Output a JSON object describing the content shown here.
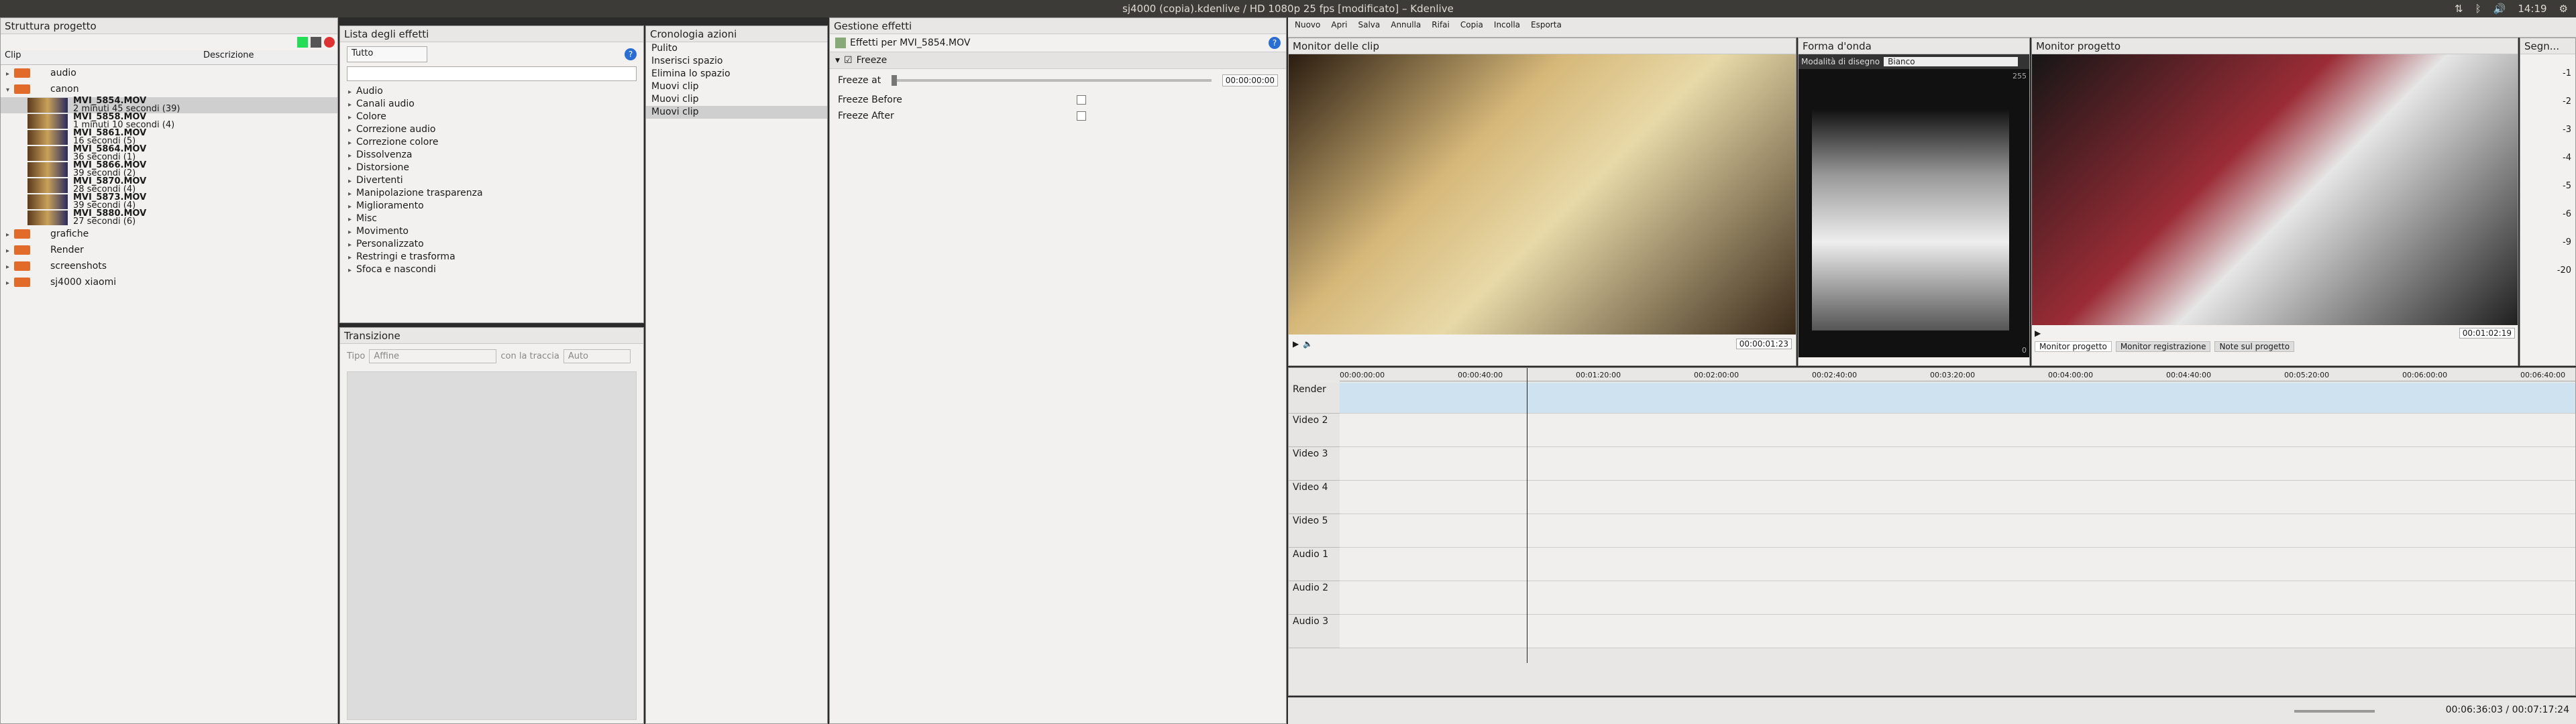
{
  "window": {
    "title": "sj4000 (copia).kdenlive / HD 1080p 25 fps [modificato] – Kdenlive",
    "clock": "14:19"
  },
  "project": {
    "title": "Struttura progetto",
    "col_clip": "Clip",
    "col_desc": "Descrizione",
    "tree": [
      {
        "type": "folder",
        "name": "audio",
        "open": false
      },
      {
        "type": "folder",
        "name": "canon",
        "open": true
      },
      {
        "type": "clip",
        "name": "MVI_5854.MOV",
        "desc": "2 minuti 45 secondi (39)",
        "selected": true
      },
      {
        "type": "clip",
        "name": "MVI_5858.MOV",
        "desc": "1 minuti 10 secondi (4)"
      },
      {
        "type": "clip",
        "name": "MVI_5861.MOV",
        "desc": "16 secondi (5)"
      },
      {
        "type": "clip",
        "name": "MVI_5864.MOV",
        "desc": "36 secondi (1)"
      },
      {
        "type": "clip",
        "name": "MVI_5866.MOV",
        "desc": "39 secondi (2)"
      },
      {
        "type": "clip",
        "name": "MVI_5870.MOV",
        "desc": "28 secondi (4)"
      },
      {
        "type": "clip",
        "name": "MVI_5873.MOV",
        "desc": "39 secondi (4)"
      },
      {
        "type": "clip",
        "name": "MVI_5880.MOV",
        "desc": "27 secondi (6)"
      },
      {
        "type": "folder",
        "name": "grafiche",
        "open": false
      },
      {
        "type": "folder",
        "name": "Render",
        "open": false
      },
      {
        "type": "folder",
        "name": "screenshots",
        "open": false
      },
      {
        "type": "folder",
        "name": "sj4000 xiaomi",
        "open": false
      }
    ]
  },
  "effects_list": {
    "title": "Lista degli effetti",
    "filter": "Tutto",
    "categories": [
      "Audio",
      "Canali audio",
      "Colore",
      "Correzione audio",
      "Correzione colore",
      "Dissolvenza",
      "Distorsione",
      "Divertenti",
      "Manipolazione trasparenza",
      "Miglioramento",
      "Misc",
      "Movimento",
      "Personalizzato",
      "Restringi e trasforma",
      "Sfoca e nascondi"
    ]
  },
  "transition": {
    "title": "Transizione",
    "tipo_label": "Tipo",
    "tipo_value": "Affine",
    "track_label": "con la traccia",
    "track_value": "Auto"
  },
  "history": {
    "title": "Cronologia azioni",
    "items": [
      "Pulito",
      "Inserisci spazio",
      "Elimina lo spazio",
      "Muovi clip",
      "Muovi clip",
      "Muovi clip"
    ]
  },
  "effect_stack": {
    "title": "Gestione effetti",
    "subtitle": "Effetti per MVI_5854.MOV",
    "effect_name": "Freeze",
    "freeze_at_label": "Freeze at",
    "freeze_at_value": "00:00:00:00",
    "freeze_before": "Freeze Before",
    "freeze_after": "Freeze After"
  },
  "toolbar": {
    "items": [
      "Nuovo",
      "Apri",
      "Salva",
      "Annulla",
      "Rifai",
      "Copia",
      "Incolla",
      "Esporta"
    ]
  },
  "clip_monitor": {
    "title": "Monitor delle clip",
    "timecode": "00:00:01:23"
  },
  "waveform": {
    "title": "Forma d'onda",
    "mode_label": "Modalità di disegno",
    "mode_value": "Bianco",
    "top": "255",
    "bottom": "0"
  },
  "project_monitor": {
    "title": "Monitor progetto",
    "timecode": "00:01:02:19",
    "tabs": [
      "Monitor progetto",
      "Monitor registrazione",
      "Note sul progetto"
    ]
  },
  "vectorscope": {
    "title": "Segn...",
    "scale": [
      "-1",
      "-2",
      "-3",
      "-4",
      "-5",
      "-6",
      "-9",
      "-20"
    ]
  },
  "timeline": {
    "ruler": [
      "00:00:00:00",
      "00:00:40:00",
      "00:01:20:00",
      "00:02:00:00",
      "00:02:40:00",
      "00:03:20:00",
      "00:04:00:00",
      "00:04:40:00",
      "00:05:20:00",
      "00:06:00:00",
      "00:06:40:00"
    ],
    "tracks": [
      "Render",
      "Video 2",
      "Video 3",
      "Video 4",
      "Video 5",
      "Audio 1",
      "Audio 2",
      "Audio 3"
    ],
    "status_time": "00:06:36:03 / 00:07:17:24"
  },
  "colors": {
    "accent": "#e06b2a",
    "audio": "#8fbf9f",
    "render": "#cfe2f0"
  }
}
